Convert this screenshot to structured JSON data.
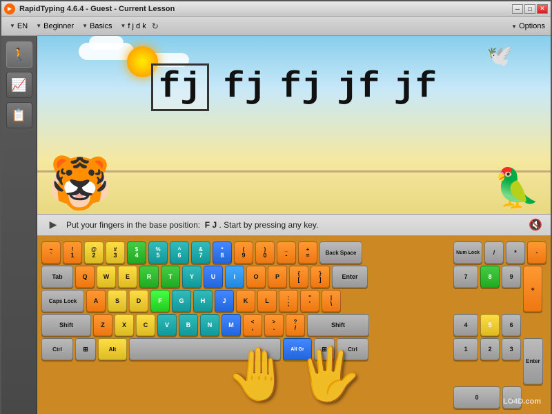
{
  "titleBar": {
    "title": "RapidTyping 4.6.4 - Guest - Current Lesson",
    "minimize": "─",
    "restore": "□",
    "close": "✕"
  },
  "toolbar": {
    "lang": "EN",
    "level": "Beginner",
    "category": "Basics",
    "lesson": "f j d k",
    "options": "Options"
  },
  "sidebar": {
    "items": [
      {
        "icon": "🚶",
        "name": "typing-mode"
      },
      {
        "icon": "📈",
        "name": "stats"
      },
      {
        "icon": "📋",
        "name": "lessons"
      }
    ]
  },
  "lessonText": {
    "chars": [
      "fj",
      "fj",
      "fj",
      "jf",
      "jf"
    ]
  },
  "statusBar": {
    "instruction": "Put your fingers in the base position:  F  J . Start by pressing any key.",
    "highlightKeys": [
      "F",
      "J"
    ]
  },
  "keyboard": {
    "rows": [
      [
        "~`",
        "!1",
        "@2",
        "#3",
        "$4",
        "%5",
        "^6",
        "&7",
        "*8",
        "(9",
        ")0",
        "_-",
        "+=",
        "Back Space"
      ],
      [
        "Tab",
        "Q",
        "W",
        "E",
        "R",
        "T",
        "Y",
        "U",
        "I",
        "O",
        "P",
        "{[",
        "]}",
        "\\|"
      ],
      [
        "Caps Lock",
        "A",
        "S",
        "D",
        "F",
        "G",
        "H",
        "J",
        "K",
        "L",
        ":;",
        "\"'",
        "Enter"
      ],
      [
        "Shift",
        "Z",
        "X",
        "C",
        "V",
        "B",
        "N",
        "M",
        "<,",
        ">.",
        "?/",
        "Shift"
      ],
      [
        "Ctrl",
        "Alt",
        "",
        "",
        "",
        "",
        "",
        "",
        "",
        "Alt Gr",
        "Ctrl"
      ]
    ]
  },
  "watermark": "LO4D.com"
}
